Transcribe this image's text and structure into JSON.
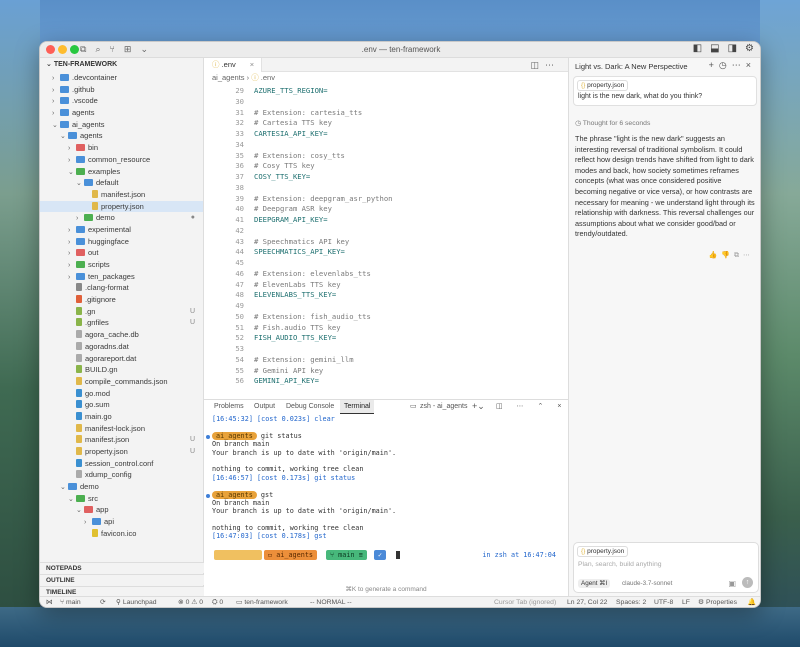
{
  "window": {
    "title": ".env — ten-framework"
  },
  "sidebar": {
    "header": "TEN-FRAMEWORK",
    "items": [
      {
        "label": ".devcontainer",
        "depth": 1,
        "type": "folder",
        "open": false,
        "color": "#4a90d9"
      },
      {
        "label": ".github",
        "depth": 1,
        "type": "folder",
        "open": false,
        "color": "#4a90d9"
      },
      {
        "label": ".vscode",
        "depth": 1,
        "type": "folder",
        "open": false,
        "color": "#4a90d9"
      },
      {
        "label": "agents",
        "depth": 1,
        "type": "folder",
        "open": false,
        "color": "#4a90d9"
      },
      {
        "label": "ai_agents",
        "depth": 1,
        "type": "folder",
        "open": true,
        "color": "#4a90d9"
      },
      {
        "label": "agents",
        "depth": 2,
        "type": "folder",
        "open": true,
        "color": "#4a90d9"
      },
      {
        "label": "bin",
        "depth": 3,
        "type": "folder",
        "open": false,
        "color": "#e06060"
      },
      {
        "label": "common_resource",
        "depth": 3,
        "type": "folder",
        "open": false,
        "color": "#4a90d9"
      },
      {
        "label": "examples",
        "depth": 3,
        "type": "folder",
        "open": true,
        "color": "#4caf50"
      },
      {
        "label": "default",
        "depth": 4,
        "type": "folder",
        "open": true,
        "color": "#4a90d9"
      },
      {
        "label": "manifest.json",
        "depth": 5,
        "type": "file",
        "color": "#e0b84a",
        "badge": ""
      },
      {
        "label": "property.json",
        "depth": 5,
        "type": "file",
        "color": "#e0b84a",
        "badge": "",
        "selected": true
      },
      {
        "label": "demo",
        "depth": 4,
        "type": "folder",
        "open": false,
        "color": "#4caf50",
        "badge": "●"
      },
      {
        "label": "experimental",
        "depth": 3,
        "type": "folder",
        "open": false,
        "color": "#4a90d9"
      },
      {
        "label": "huggingface",
        "depth": 3,
        "type": "folder",
        "open": false,
        "color": "#4a90d9"
      },
      {
        "label": "out",
        "depth": 3,
        "type": "folder",
        "open": false,
        "color": "#e06060"
      },
      {
        "label": "scripts",
        "depth": 3,
        "type": "folder",
        "open": false,
        "color": "#4caf50"
      },
      {
        "label": "ten_packages",
        "depth": 3,
        "type": "folder",
        "open": false,
        "color": "#4a90d9"
      },
      {
        "label": ".clang-format",
        "depth": 3,
        "type": "file",
        "color": "#888"
      },
      {
        "label": ".gitignore",
        "depth": 3,
        "type": "file",
        "color": "#e0603a"
      },
      {
        "label": ".gn",
        "depth": 3,
        "type": "file",
        "color": "#8ab44a",
        "badge": "U"
      },
      {
        "label": ".gnfiles",
        "depth": 3,
        "type": "file",
        "color": "#8ab44a",
        "badge": "U"
      },
      {
        "label": "agora_cache.db",
        "depth": 3,
        "type": "file",
        "color": "#aaa"
      },
      {
        "label": "agoradns.dat",
        "depth": 3,
        "type": "file",
        "color": "#aaa"
      },
      {
        "label": "agorareport.dat",
        "depth": 3,
        "type": "file",
        "color": "#aaa"
      },
      {
        "label": "BUILD.gn",
        "depth": 3,
        "type": "file",
        "color": "#8ab44a"
      },
      {
        "label": "compile_commands.json",
        "depth": 3,
        "type": "file",
        "color": "#e0b84a"
      },
      {
        "label": "go.mod",
        "depth": 3,
        "type": "file",
        "color": "#3a8fd0"
      },
      {
        "label": "go.sum",
        "depth": 3,
        "type": "file",
        "color": "#3a8fd0"
      },
      {
        "label": "main.go",
        "depth": 3,
        "type": "file",
        "color": "#3a8fd0"
      },
      {
        "label": "manifest-lock.json",
        "depth": 3,
        "type": "file",
        "color": "#e0b84a"
      },
      {
        "label": "manifest.json",
        "depth": 3,
        "type": "file",
        "color": "#e0b84a",
        "badge": "U"
      },
      {
        "label": "property.json",
        "depth": 3,
        "type": "file",
        "color": "#e0b84a",
        "badge": "U"
      },
      {
        "label": "session_control.conf",
        "depth": 3,
        "type": "file",
        "color": "#3a8fd0"
      },
      {
        "label": "xdump_config",
        "depth": 3,
        "type": "file",
        "color": "#aaa"
      },
      {
        "label": "demo",
        "depth": 2,
        "type": "folder",
        "open": true,
        "color": "#4a90d9"
      },
      {
        "label": "src",
        "depth": 3,
        "type": "folder",
        "open": true,
        "color": "#4caf50"
      },
      {
        "label": "app",
        "depth": 4,
        "type": "folder",
        "open": true,
        "color": "#e06060"
      },
      {
        "label": "api",
        "depth": 5,
        "type": "folder",
        "open": false,
        "color": "#4a90d9"
      },
      {
        "label": "favicon.ico",
        "depth": 5,
        "type": "file",
        "color": "#e0c030"
      }
    ],
    "sections": [
      "NOTEPADS",
      "OUTLINE",
      "TIMELINE"
    ]
  },
  "editor": {
    "tab": ".env",
    "breadcrumb": [
      "ai_agents",
      ".env"
    ],
    "lines": [
      {
        "n": "29",
        "t": "AZURE_TTS_REGION=",
        "k": "kv"
      },
      {
        "n": "30",
        "t": "",
        "k": ""
      },
      {
        "n": "31",
        "t": "# Extension: cartesia_tts",
        "k": "cm"
      },
      {
        "n": "32",
        "t": "# Cartesia TTS key",
        "k": "cm"
      },
      {
        "n": "33",
        "t": "CARTESIA_API_KEY=",
        "k": "kv"
      },
      {
        "n": "34",
        "t": "",
        "k": ""
      },
      {
        "n": "35",
        "t": "# Extension: cosy_tts",
        "k": "cm"
      },
      {
        "n": "36",
        "t": "# Cosy TTS key",
        "k": "cm"
      },
      {
        "n": "37",
        "t": "COSY_TTS_KEY=",
        "k": "kv"
      },
      {
        "n": "38",
        "t": "",
        "k": ""
      },
      {
        "n": "39",
        "t": "# Extension: deepgram_asr_python",
        "k": "cm"
      },
      {
        "n": "40",
        "t": "# Deepgram ASR key",
        "k": "cm"
      },
      {
        "n": "41",
        "t": "DEEPGRAM_API_KEY=",
        "k": "kv"
      },
      {
        "n": "42",
        "t": "",
        "k": ""
      },
      {
        "n": "43",
        "t": "# Speechmatics API key",
        "k": "cm"
      },
      {
        "n": "44",
        "t": "SPEECHMATICS_API_KEY=",
        "k": "kv"
      },
      {
        "n": "45",
        "t": "",
        "k": ""
      },
      {
        "n": "46",
        "t": "# Extension: elevenlabs_tts",
        "k": "cm"
      },
      {
        "n": "47",
        "t": "# ElevenLabs TTS key",
        "k": "cm"
      },
      {
        "n": "48",
        "t": "ELEVENLABS_TTS_KEY=",
        "k": "kv"
      },
      {
        "n": "49",
        "t": "",
        "k": ""
      },
      {
        "n": "50",
        "t": "# Extension: fish_audio_tts",
        "k": "cm"
      },
      {
        "n": "51",
        "t": "# Fish.audio TTS key",
        "k": "cm"
      },
      {
        "n": "52",
        "t": "FISH_AUDIO_TTS_KEY=",
        "k": "kv"
      },
      {
        "n": "53",
        "t": "",
        "k": ""
      },
      {
        "n": "54",
        "t": "# Extension: gemini_llm",
        "k": "cm"
      },
      {
        "n": "55",
        "t": "# Gemini API key",
        "k": "cm"
      },
      {
        "n": "56",
        "t": "GEMINI_API_KEY=",
        "k": "kv"
      }
    ]
  },
  "panel": {
    "tabs": [
      "Problems",
      "Output",
      "Debug Console",
      "Terminal"
    ],
    "active_tab": "Terminal",
    "shell": "zsh - ai_agents",
    "lines": [
      {
        "t": "[16:45:32] [cost 0.023s] clear",
        "c": "blue"
      },
      {
        "t": "",
        "c": ""
      },
      {
        "t": "ai_agents",
        "c": "pill",
        "after": " git status",
        "dot": true
      },
      {
        "t": "On branch main",
        "c": ""
      },
      {
        "t": "Your branch is up to date with 'origin/main'.",
        "c": ""
      },
      {
        "t": "",
        "c": ""
      },
      {
        "t": "nothing to commit, working tree clean",
        "c": ""
      },
      {
        "t": "[16:46:57] [cost 0.173s] git status",
        "c": "blue"
      },
      {
        "t": "",
        "c": ""
      },
      {
        "t": "ai_agents",
        "c": "pill",
        "after": " gst",
        "dot": true
      },
      {
        "t": "On branch main",
        "c": ""
      },
      {
        "t": "Your branch is up to date with 'origin/main'.",
        "c": ""
      },
      {
        "t": "",
        "c": ""
      },
      {
        "t": "nothing to commit, working tree clean",
        "c": ""
      },
      {
        "t": "[16:47:03] [cost 0.178s] gst",
        "c": "blue"
      }
    ],
    "prompt": {
      "seg1": "ai_agents",
      "seg2": "main",
      "seg3": "✓",
      "right": "in zsh at 16:47:04"
    },
    "hint": "⌘K to generate a command"
  },
  "chat": {
    "title": "Light vs. Dark: A New Perspective",
    "context_chip": "property.json",
    "user_message": "light is the new dark, what do you think?",
    "thought": "Thought for 6 seconds",
    "answer": "The phrase \"light is the new dark\" suggests an interesting reversal of traditional symbolism. It could reflect how design trends have shifted from light to dark modes and back, how society sometimes reframes concepts (what was once considered positive becoming negative or vice versa), or how contrasts are necessary for meaning - we understand light through its relationship with darkness. This reversal challenges our assumptions about what we consider good/bad or trendy/outdated.",
    "input_chip": "property.json",
    "placeholder": "Plan, search, build anything",
    "agent_label": "Agent ⌘I",
    "model": "claude-3.7-sonnet"
  },
  "status": {
    "branch": "main",
    "launchpad": "Launchpad",
    "problems": "⊗ 0 ⚠ 0",
    "ports": "0",
    "project": "ten-framework",
    "mode": "-- NORMAL --",
    "cursor_tab": "Cursor Tab (ignored)",
    "position": "Ln 27, Col 22",
    "spaces": "Spaces: 2",
    "encoding": "UTF-8",
    "eol": "LF",
    "language": "Properties"
  }
}
